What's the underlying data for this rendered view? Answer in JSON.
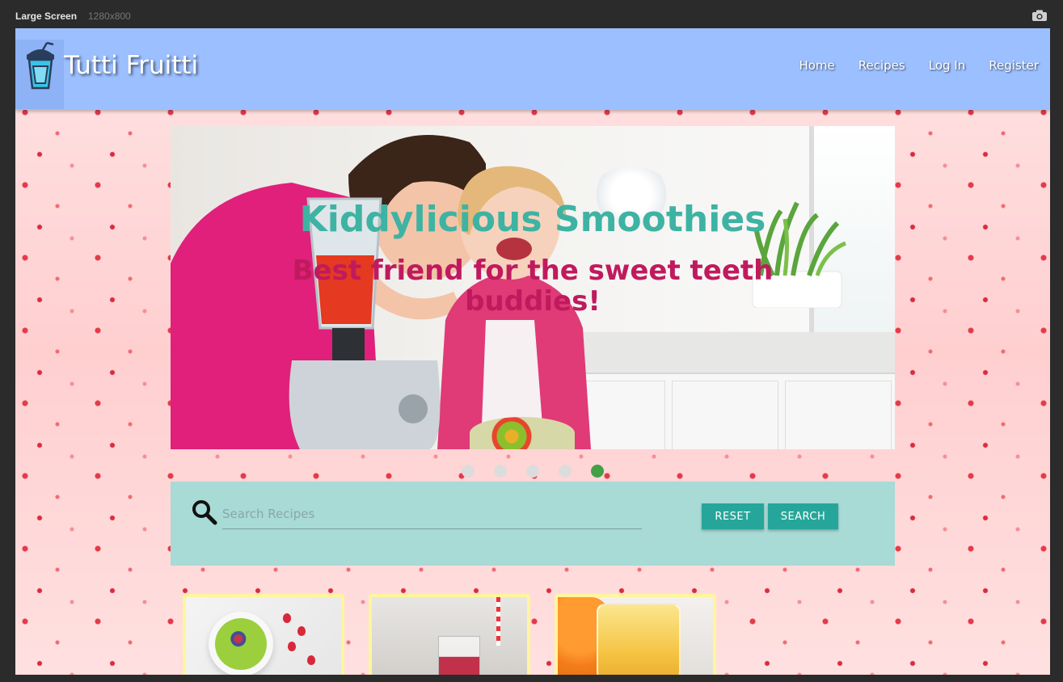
{
  "devtools": {
    "label": "Large Screen",
    "resolution": "1280x800",
    "screenshot_icon": "camera-icon"
  },
  "navbar": {
    "logo_icon": "smoothie-cup-icon",
    "brand": "Tutti Fruitti",
    "links": [
      {
        "label": "Home"
      },
      {
        "label": "Recipes"
      },
      {
        "label": "Log In"
      },
      {
        "label": "Register"
      }
    ],
    "background_color": "#9bbfff"
  },
  "carousel": {
    "title": "Kiddylicious Smoothies",
    "subtitle": "Best friend for the sweet teeth buddies!",
    "title_color": "#3eb3a3",
    "subtitle_color": "#c01a5e",
    "slide_count": 5,
    "active_index": 4,
    "active_color": "#43a047"
  },
  "search": {
    "icon": "search-icon",
    "placeholder": "Search Recipes",
    "value": "",
    "reset_label": "RESET",
    "search_label": "SEARCH",
    "panel_color": "#a8dad6",
    "button_color": "#26a69a"
  },
  "recipe_cards": [
    {
      "image": "green-smoothie-bowl"
    },
    {
      "image": "berry-smoothie-glass"
    },
    {
      "image": "orange-smoothie-glass"
    }
  ]
}
